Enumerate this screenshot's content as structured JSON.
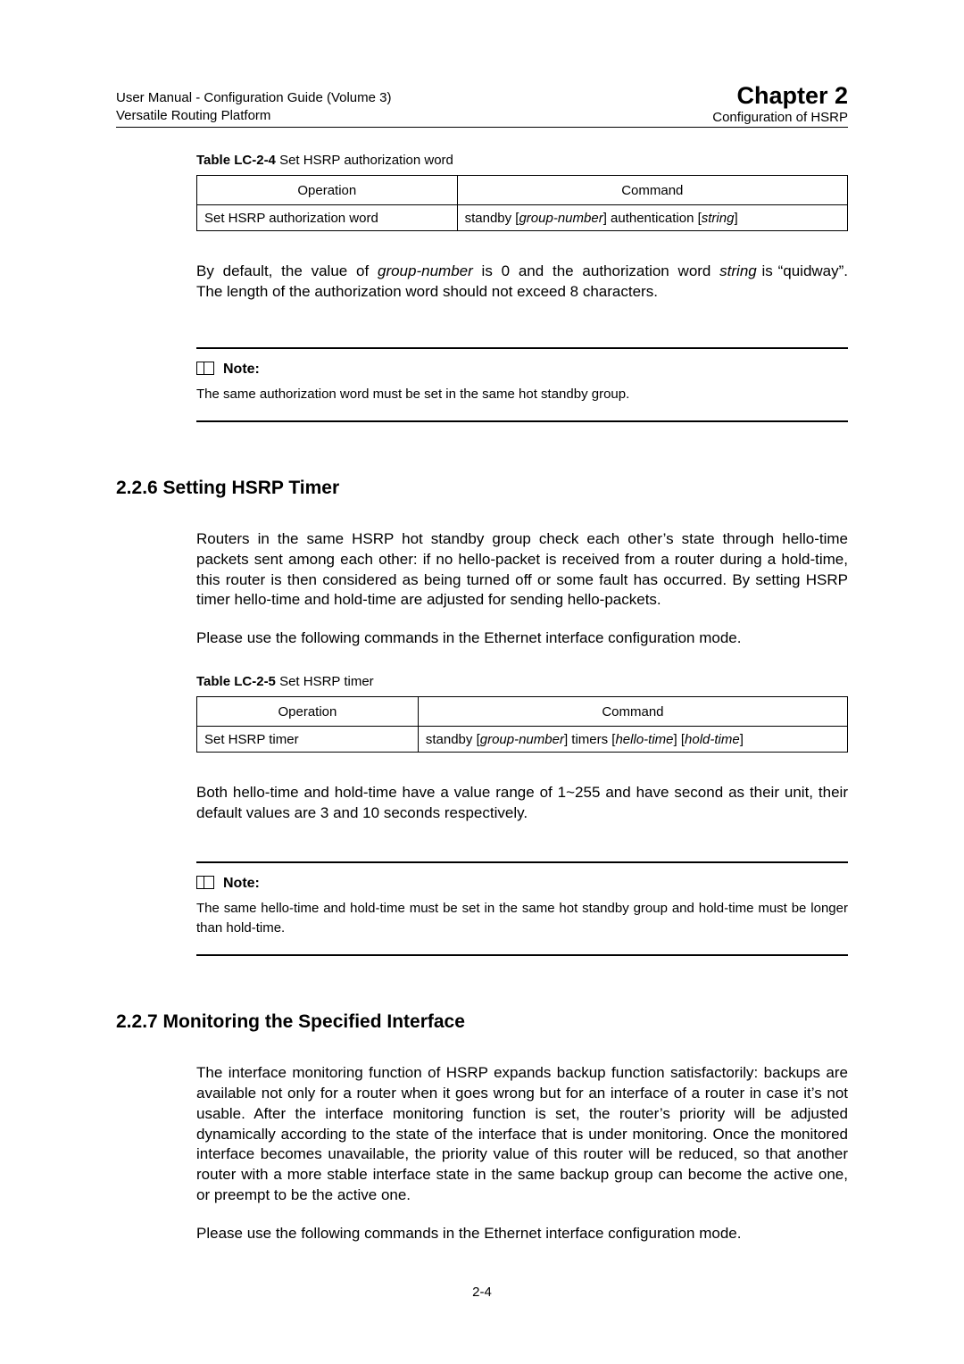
{
  "header": {
    "left_line1": "User Manual - Configuration Guide (Volume 3)",
    "left_line2": "Versatile Routing Platform",
    "right_chapter": "Chapter 2",
    "right_sub": "Configuration of HSRP"
  },
  "table1": {
    "caption_prefix": "Table LC-2-4",
    "caption_rest": "  Set HSRP authorization word",
    "col1": "Operation",
    "col2": "Command",
    "row1_op": "Set HSRP authorization word",
    "row1_cmd_pre": "standby [",
    "row1_cmd_arg1": "group-number",
    "row1_cmd_mid": "] authentication [",
    "row1_cmd_arg2": "string",
    "row1_cmd_post": "]"
  },
  "para1_a": "By default, the value of ",
  "para1_b": "group-number",
  "para1_c": " is 0 and the authorization word ",
  "para1_d": "string",
  "para1_e": " is “quidway”. The length of the authorization word should not exceed 8 characters.",
  "note1_title": "Note:",
  "note1_text": "The same authorization word must be set in the same hot standby group.",
  "sec226": "2.2.6  Setting HSRP Timer",
  "para2": "Routers in the same HSRP hot standby group check each other’s state through hello-time packets sent among each other: if no hello-packet is received from a router during a hold-time, this router is then considered as being turned off or some fault has occurred. By setting HSRP timer hello-time and hold-time are adjusted for sending hello-packets.",
  "para3": "Please use the following commands in the Ethernet interface configuration mode.",
  "table2": {
    "caption_prefix": "Table LC-2-5",
    "caption_rest": "  Set HSRP timer",
    "col1": "Operation",
    "col2": "Command",
    "row1_op": "Set HSRP timer",
    "row1_cmd_pre": "standby [",
    "row1_cmd_arg1": "group-number",
    "row1_cmd_mid": "] timers [",
    "row1_cmd_arg2": "hello-time",
    "row1_cmd_mid2": "] [",
    "row1_cmd_arg3": "hold-time",
    "row1_cmd_post": "]"
  },
  "para4": "Both hello-time and hold-time have a value range of 1~255 and have second as their unit, their default values are 3 and 10 seconds respectively.",
  "note2_title": "Note:",
  "note2_text": "The same hello-time and hold-time must be set in the same hot standby group and hold-time must be longer than hold-time.",
  "sec227": "2.2.7  Monitoring the Specified Interface",
  "para5": "The interface monitoring function of HSRP expands backup function satisfactorily: backups are available not only for a router when it goes wrong but for an interface of a router in case it’s not usable. After the interface monitoring function is set, the router’s priority will be adjusted dynamically according to the state of the interface that is under monitoring. Once the monitored interface becomes unavailable, the priority value of this router will be reduced, so that another router with a more stable interface state in the same backup group can become the active one, or preempt to be the active one.",
  "para6": "Please use the following commands in the Ethernet interface configuration mode.",
  "pagenum": "2-4"
}
